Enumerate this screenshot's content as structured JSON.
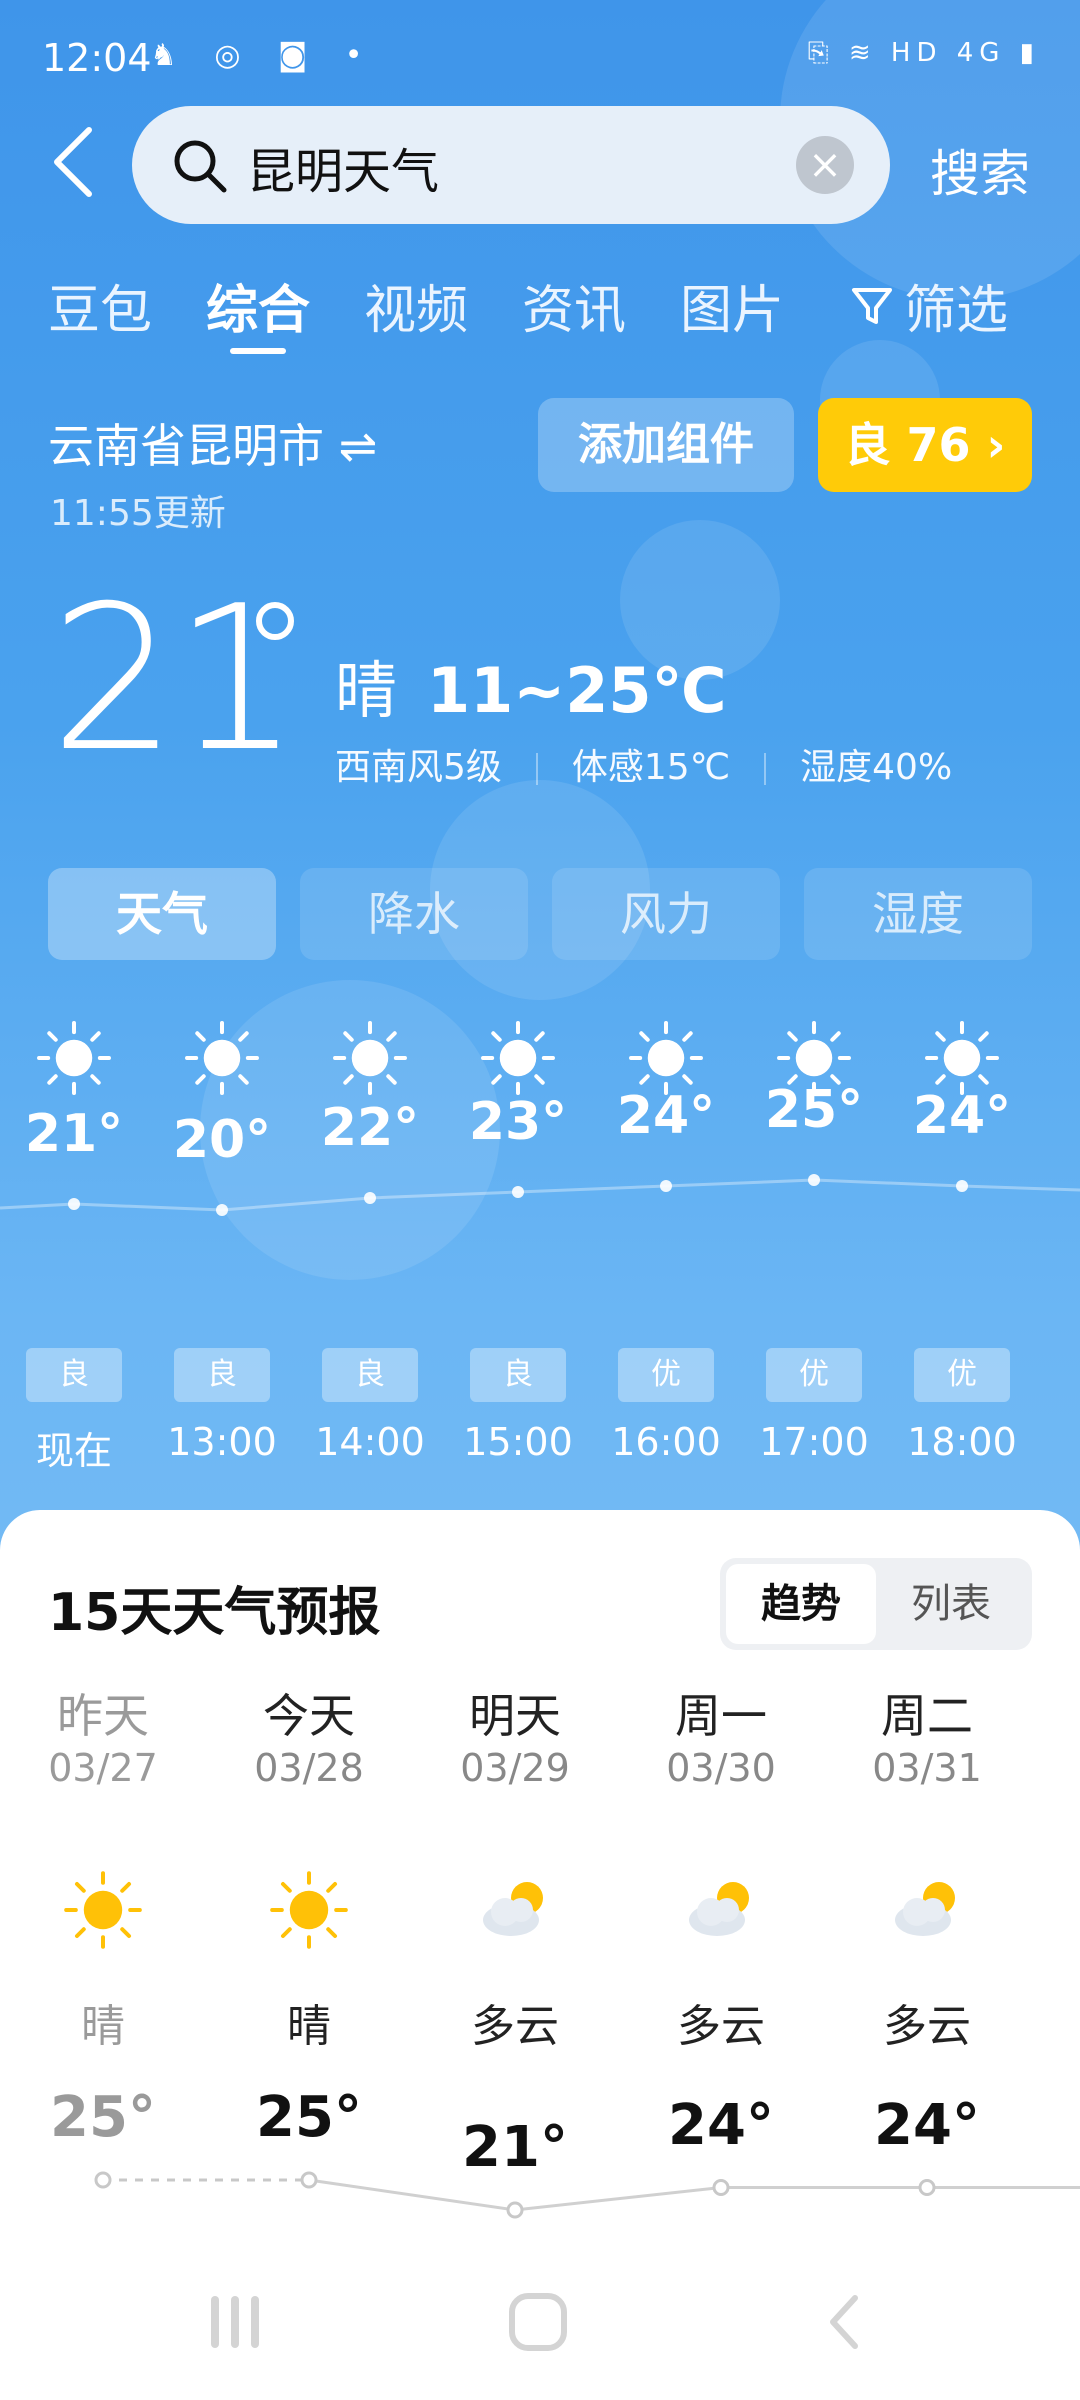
{
  "status_bar": {
    "time": "12:04",
    "left_icons": "♞ ◎ ◙ •",
    "right_icons": "⎘ ≋ HD 4G ▮"
  },
  "search": {
    "query": "昆明天气",
    "button_label": "搜索"
  },
  "tabs": [
    {
      "label": "豆包"
    },
    {
      "label": "综合",
      "active": true
    },
    {
      "label": "视频"
    },
    {
      "label": "资讯"
    },
    {
      "label": "图片"
    },
    {
      "label": "筛选"
    }
  ],
  "location": {
    "name": "云南省昆明市 ⇌",
    "updated": "11:55更新"
  },
  "actions": {
    "add_widget": "添加组件",
    "aqi": "良 76 ›"
  },
  "current": {
    "temp": "21",
    "condition": "晴",
    "range": "11~25℃",
    "wind": "西南风5级",
    "feels_like": "体感15℃",
    "humidity": "湿度40%"
  },
  "sub_tabs": [
    {
      "label": "天气",
      "active": true
    },
    {
      "label": "降水"
    },
    {
      "label": "风力"
    },
    {
      "label": "湿度"
    }
  ],
  "hourly": [
    {
      "time": "现在",
      "temp": "21°",
      "aqi": "良"
    },
    {
      "time": "13:00",
      "temp": "20°",
      "aqi": "良"
    },
    {
      "time": "14:00",
      "temp": "22°",
      "aqi": "良"
    },
    {
      "time": "15:00",
      "temp": "23°",
      "aqi": "良"
    },
    {
      "time": "16:00",
      "temp": "24°",
      "aqi": "优"
    },
    {
      "time": "17:00",
      "temp": "25°",
      "aqi": "优"
    },
    {
      "time": "18:00",
      "temp": "24°",
      "aqi": "优"
    }
  ],
  "forecast": {
    "title": "15天天气预报",
    "toggle": [
      "趋势",
      "列表"
    ],
    "days": [
      {
        "name": "昨天",
        "date": "03/27",
        "icon": "sun-icon",
        "condition": "晴",
        "high": "25°"
      },
      {
        "name": "今天",
        "date": "03/28",
        "icon": "sun-icon",
        "condition": "晴",
        "high": "25°"
      },
      {
        "name": "明天",
        "date": "03/29",
        "icon": "partly-cloudy-icon",
        "condition": "多云",
        "high": "21°"
      },
      {
        "name": "周一",
        "date": "03/30",
        "icon": "partly-cloudy-icon",
        "condition": "多云",
        "high": "24°"
      },
      {
        "name": "周二",
        "date": "03/31",
        "icon": "partly-cloudy-icon",
        "condition": "多云",
        "high": "24°"
      }
    ]
  },
  "colors": {
    "sky_top": "#3f95ea",
    "aqi_yellow": "#ffcb08",
    "sun": "#ffc107"
  }
}
